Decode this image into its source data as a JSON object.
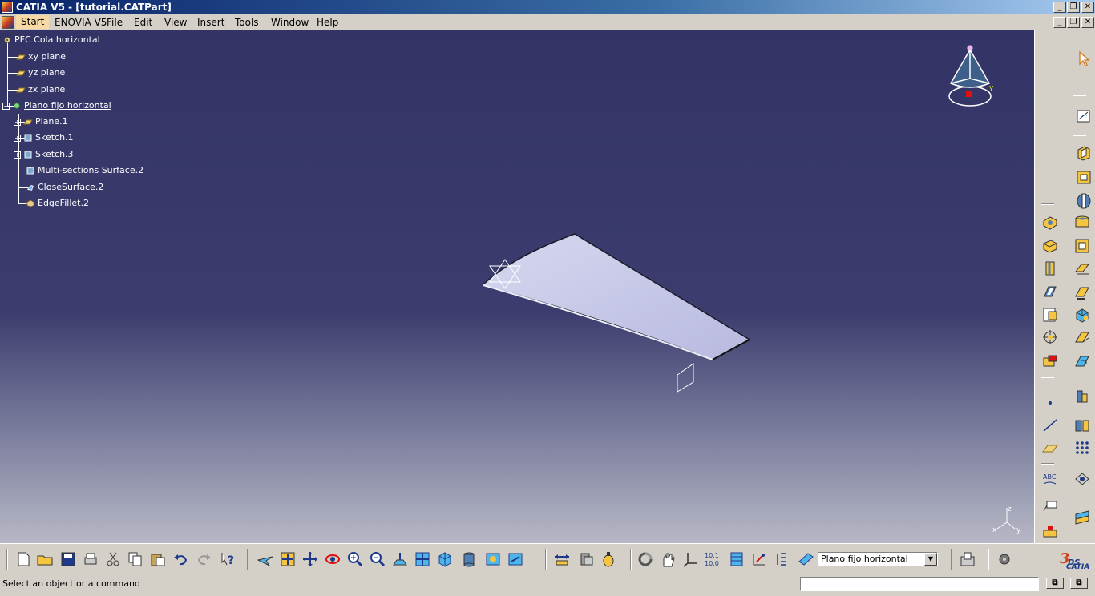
{
  "window": {
    "title": "CATIA V5 - [tutorial.CATPart]"
  },
  "menubar": {
    "items": [
      "Start",
      "ENOVIA V5",
      "File",
      "Edit",
      "View",
      "Insert",
      "Tools",
      "Window",
      "Help"
    ]
  },
  "tree": {
    "root": "PFC Cola horizontal",
    "planes": [
      "xy plane",
      "yz plane",
      "zx plane"
    ],
    "body": "Plano fijo horizontal",
    "features": [
      "Plane.1",
      "Sketch.1",
      "Sketch.3",
      "Multi-sections Surface.2",
      "CloseSurface.2",
      "EdgeFillet.2"
    ]
  },
  "compass": {
    "axes": [
      "x",
      "y",
      "z"
    ]
  },
  "toolbar_bottom": {
    "current_body": "Plano fijo horizontal",
    "icons": [
      "new-icon",
      "open-icon",
      "save-icon",
      "print-icon",
      "cut-icon",
      "copy-icon",
      "paste-icon",
      "undo-icon",
      "redo-icon",
      "whats-this-icon",
      "fly-mode-icon",
      "fit-all-icon",
      "pan-icon",
      "rotate-icon",
      "zoom-in-icon",
      "zoom-out-icon",
      "normal-view-icon",
      "multi-view-icon",
      "iso-view-icon",
      "view-mode-icon",
      "hide-show-icon",
      "swap-space-icon",
      "measure-between-icon",
      "measure-item-icon",
      "measure-inertia-icon",
      "update-icon",
      "manipulation-icon",
      "axis-system-icon",
      "constraint-icon",
      "grid-icon",
      "parent-children-icon",
      "analysis-icon",
      "3d-compass-icon",
      "create-body-icon",
      "catalog-icon",
      "settings-icon"
    ]
  },
  "toolbar_right": {
    "icons": [
      "select-icon",
      "sketcher-icon",
      "pad-icon",
      "pocket-icon",
      "shaft-icon",
      "groove-icon",
      "hole-icon",
      "rib-icon",
      "slot-icon",
      "stiffener-icon",
      "solid-loft-icon",
      "removed-loft-icon",
      "thickness-icon",
      "draft-icon",
      "shell-icon",
      "fillet-icon",
      "chamfer-icon",
      "thread-icon",
      "translation-icon",
      "rotation-icon",
      "symmetry-icon",
      "mirror-icon",
      "point-icon",
      "line-icon",
      "plane-icon",
      "pattern-icon",
      "text-icon",
      "annotation-icon",
      "apply-material-icon",
      "split-icon",
      "sew-icon",
      "boolean-icon",
      "3d-view-icon",
      "measure-icon"
    ]
  },
  "status": {
    "message": "Select an object or a command"
  },
  "logo": "CATIA"
}
